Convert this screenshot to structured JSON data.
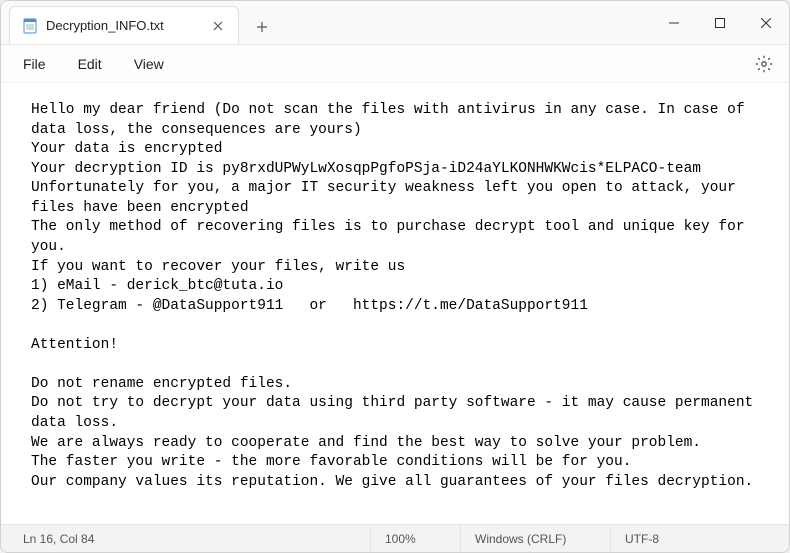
{
  "tab": {
    "title": "Decryption_INFO.txt"
  },
  "menu": {
    "file": "File",
    "edit": "Edit",
    "view": "View"
  },
  "content": {
    "text": "Hello my dear friend (Do not scan the files with antivirus in any case. In case of data loss, the consequences are yours)\nYour data is encrypted\nYour decryption ID is py8rxdUPWyLwXosqpPgfoPSja-iD24aYLKONHWKWcis*ELPACO-team\nUnfortunately for you, a major IT security weakness left you open to attack, your files have been encrypted\nThe only method of recovering files is to purchase decrypt tool and unique key for you.\nIf you want to recover your files, write us\n1) eMail - derick_btc@tuta.io\n2) Telegram - @DataSupport911   or   https://t.me/DataSupport911\n\nAttention!\n\nDo not rename encrypted files.\nDo not try to decrypt your data using third party software - it may cause permanent data loss.\nWe are always ready to cooperate and find the best way to solve your problem.\nThe faster you write - the more favorable conditions will be for you.\nOur company values its reputation. We give all guarantees of your files decryption."
  },
  "status": {
    "position": "Ln 16, Col 84",
    "zoom": "100%",
    "line_ending": "Windows (CRLF)",
    "encoding": "UTF-8"
  }
}
